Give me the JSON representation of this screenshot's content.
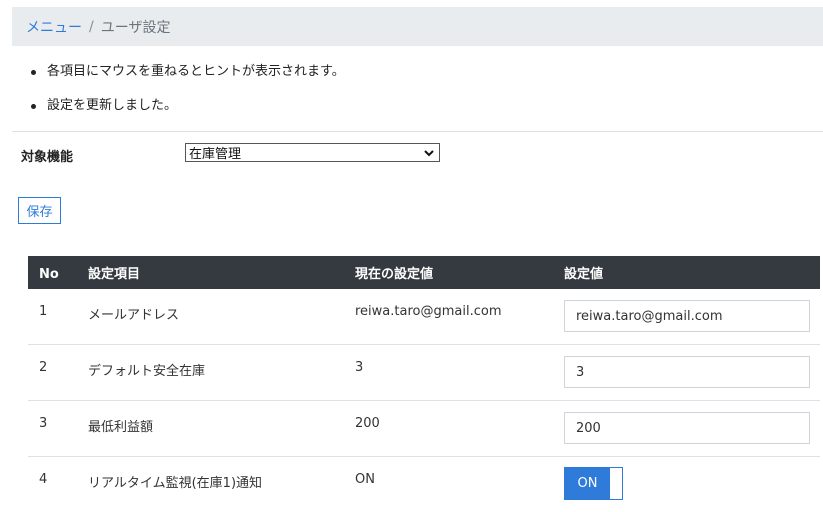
{
  "breadcrumb": {
    "parent": "メニュー",
    "separator": "/",
    "current": "ユーザ設定"
  },
  "messages": [
    "各項目にマウスを重ねるとヒントが表示されます。",
    "設定を更新しました。"
  ],
  "form": {
    "target_label": "対象機能",
    "target_selected": "在庫管理"
  },
  "toolbar": {
    "save_label": "保存"
  },
  "table": {
    "headers": {
      "no": "No",
      "item": "設定項目",
      "current": "現在の設定値",
      "setting": "設定値"
    },
    "rows": [
      {
        "no": "1",
        "item": "メールアドレス",
        "current": "reiwa.taro@gmail.com",
        "value": "reiwa.taro@gmail.com"
      },
      {
        "no": "2",
        "item": "デフォルト安全在庫",
        "current": "3",
        "value": "3"
      },
      {
        "no": "3",
        "item": "最低利益額",
        "current": "200",
        "value": "200"
      },
      {
        "no": "4",
        "item": "リアルタイム監視(在庫1)通知",
        "current": "ON",
        "toggle_label": "ON"
      }
    ]
  },
  "colors": {
    "accent": "#2f7bd9",
    "header_bg": "#343a40",
    "breadcrumb_bg": "#e9ecef"
  }
}
